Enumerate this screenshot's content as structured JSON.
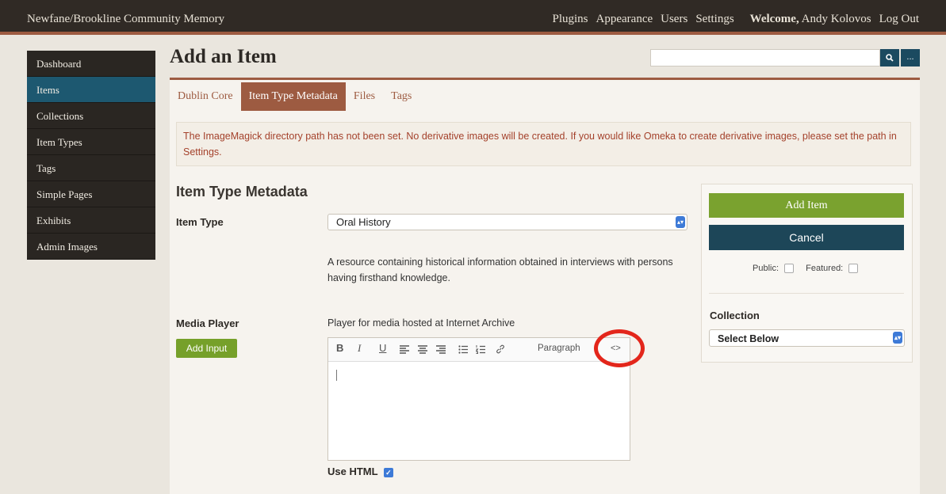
{
  "site": {
    "title": "Newfane/Brookline Community Memory",
    "nav": [
      "Plugins",
      "Appearance",
      "Users",
      "Settings"
    ],
    "welcome_prefix": "Welcome,",
    "user_name": "Andy Kolovos",
    "logout": "Log Out"
  },
  "sidebar": {
    "items": [
      {
        "label": "Dashboard"
      },
      {
        "label": "Items"
      },
      {
        "label": "Collections"
      },
      {
        "label": "Item Types"
      },
      {
        "label": "Tags"
      },
      {
        "label": "Simple Pages"
      },
      {
        "label": "Exhibits"
      },
      {
        "label": "Admin Images"
      }
    ],
    "active": "Items"
  },
  "header": {
    "title": "Add an Item",
    "search_placeholder": "",
    "search_icon": "search-icon",
    "more_label": "..."
  },
  "tabs": [
    {
      "label": "Dublin Core"
    },
    {
      "label": "Item Type Metadata"
    },
    {
      "label": "Files"
    },
    {
      "label": "Tags"
    }
  ],
  "active_tab": "Item Type Metadata",
  "notice": "The ImageMagick directory path has not been set. No derivative images will be created. If you would like Omeka to create derivative images, please set the path in Settings.",
  "form": {
    "section_title": "Item Type Metadata",
    "item_type_label": "Item Type",
    "item_type_value": "Oral History",
    "item_type_description": "A resource containing historical information obtained in interviews with persons having firsthand knowledge.",
    "media_player_label": "Media Player",
    "media_player_description": "Player for media hosted at Internet Archive",
    "add_input_label": "Add Input",
    "editor_toolbar": {
      "bold": "B",
      "italic": "I",
      "underline": "U",
      "paragraph": "Paragraph",
      "code": "<>"
    },
    "use_html_label": "Use HTML",
    "use_html_checked": true
  },
  "side": {
    "add_item": "Add Item",
    "cancel": "Cancel",
    "public_label": "Public:",
    "featured_label": "Featured:",
    "collection_label": "Collection",
    "collection_value": "Select Below"
  },
  "colors": {
    "brand": "#9d5b41",
    "nav_dark": "#302a25",
    "active_blue": "#1d5870",
    "add_green": "#7aa22f",
    "notice_red": "#a4412b",
    "highlight_red": "#e3261b"
  }
}
